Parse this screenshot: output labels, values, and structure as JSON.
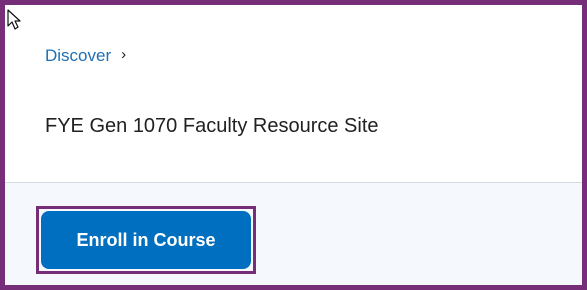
{
  "breadcrumb": {
    "link_label": "Discover",
    "separator_icon": "chevron-right-icon",
    "separator_glyph": "›"
  },
  "page": {
    "title": "FYE Gen 1070 Faculty Resource Site"
  },
  "actions": {
    "enroll_label": "Enroll in Course"
  },
  "colors": {
    "highlight": "#772e78",
    "button": "#006fbf",
    "link": "#1f6fb5"
  }
}
